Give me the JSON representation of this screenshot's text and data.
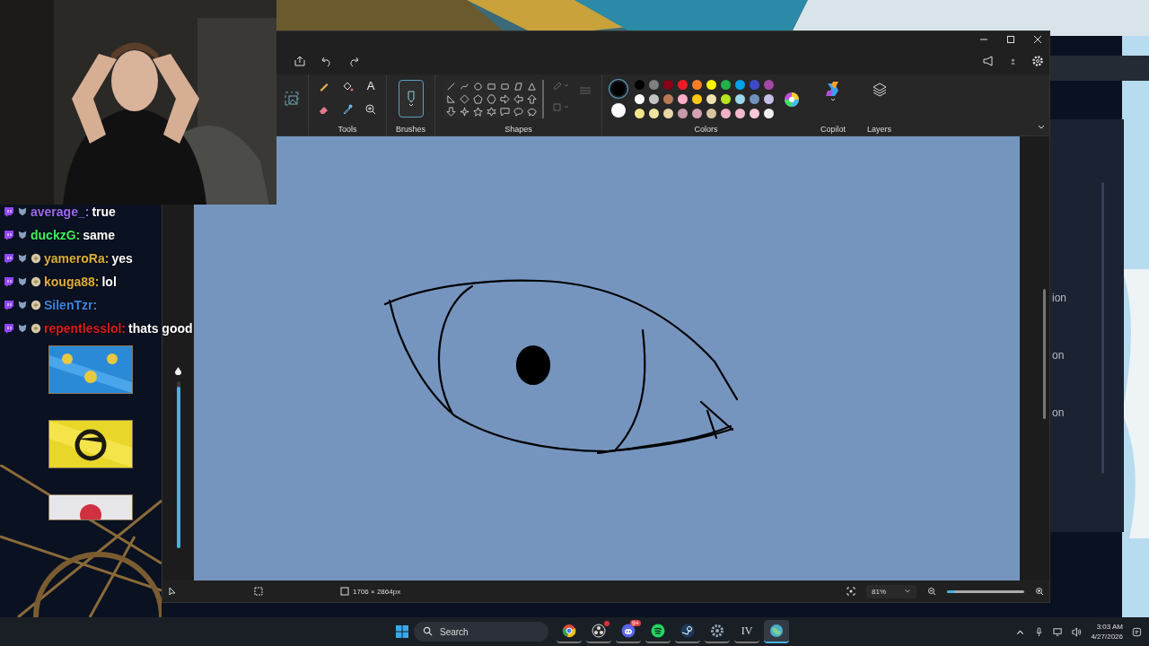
{
  "chat": [
    {
      "user": "average_:",
      "message": "true",
      "color": "#9b6cf0"
    },
    {
      "user": "duckzG:",
      "message": "same",
      "color": "#3ef05c"
    },
    {
      "user": "yameroRa:",
      "message": "yes",
      "color": "#dcae3c"
    },
    {
      "user": "kouga88:",
      "message": "lol",
      "color": "#dcae3c"
    },
    {
      "user": "SilenTzr:",
      "color": "#3a86e0"
    },
    {
      "user": "repentlesslol:",
      "message": "thats good",
      "color": "#e01c1c"
    }
  ],
  "game_panel": {
    "labels": [
      "ion",
      "on",
      "on"
    ]
  },
  "paint": {
    "ribbon": {
      "text_tool_glyph": "A",
      "tools": "Tools",
      "brushes": "Brushes",
      "shapes": "Shapes",
      "colors": "Colors",
      "copilot": "Copilot",
      "layers": "Layers"
    },
    "colors": {
      "primary": {
        "color": "#000000"
      },
      "secondary": {
        "color": "#ffffff"
      },
      "swatches": [
        {
          "color": "#000000"
        },
        {
          "color": "#7f7f7f"
        },
        {
          "color": "#880015"
        },
        {
          "color": "#ed1c24"
        },
        {
          "color": "#ff7f27"
        },
        {
          "color": "#fff200"
        },
        {
          "color": "#22b14c"
        },
        {
          "color": "#00a2e8"
        },
        {
          "color": "#3f48cc"
        },
        {
          "color": "#a349a4"
        },
        {
          "color": "#ffffff"
        },
        {
          "color": "#c3c3c3"
        },
        {
          "color": "#b97a57"
        },
        {
          "color": "#ffaec9"
        },
        {
          "color": "#ffc90e"
        },
        {
          "color": "#efe4b0"
        },
        {
          "color": "#b5e61d"
        },
        {
          "color": "#99d9ea"
        },
        {
          "color": "#7092be"
        },
        {
          "color": "#c8bfe7"
        },
        {
          "color": "#f4e58a"
        },
        {
          "color": "#f1e6a0"
        },
        {
          "color": "#e8d7a8"
        },
        {
          "color": "#c99aa8"
        },
        {
          "color": "#d4a0b4"
        },
        {
          "color": "#d8c3a0"
        },
        {
          "color": "#f0b0c8"
        },
        {
          "color": "#f4b8d0"
        },
        {
          "color": "#f8c8dc"
        },
        {
          "color": "#f0f0f0"
        }
      ]
    },
    "side_slider": {
      "level": 0.97
    },
    "status_bar": {
      "canvas_size": "1706 × 2864px",
      "zoom": "81%",
      "zoom_slider": {
        "level": 0.1
      }
    }
  },
  "taskbar": {
    "search_placeholder": "Search",
    "apps": [
      {
        "kind": "chrome",
        "selected": false
      },
      {
        "kind": "obs",
        "selected": false
      },
      {
        "kind": "discord",
        "selected": false,
        "badge": "9+"
      },
      {
        "kind": "spotify",
        "selected": false
      },
      {
        "kind": "steam",
        "selected": false
      },
      {
        "kind": "settings",
        "selected": false
      },
      {
        "kind": "monogram",
        "selected": false,
        "label": "IV"
      },
      {
        "kind": "globe",
        "selected": true
      }
    ],
    "clock": {
      "time": "3:03 AM",
      "date": "4/27/2026"
    }
  }
}
